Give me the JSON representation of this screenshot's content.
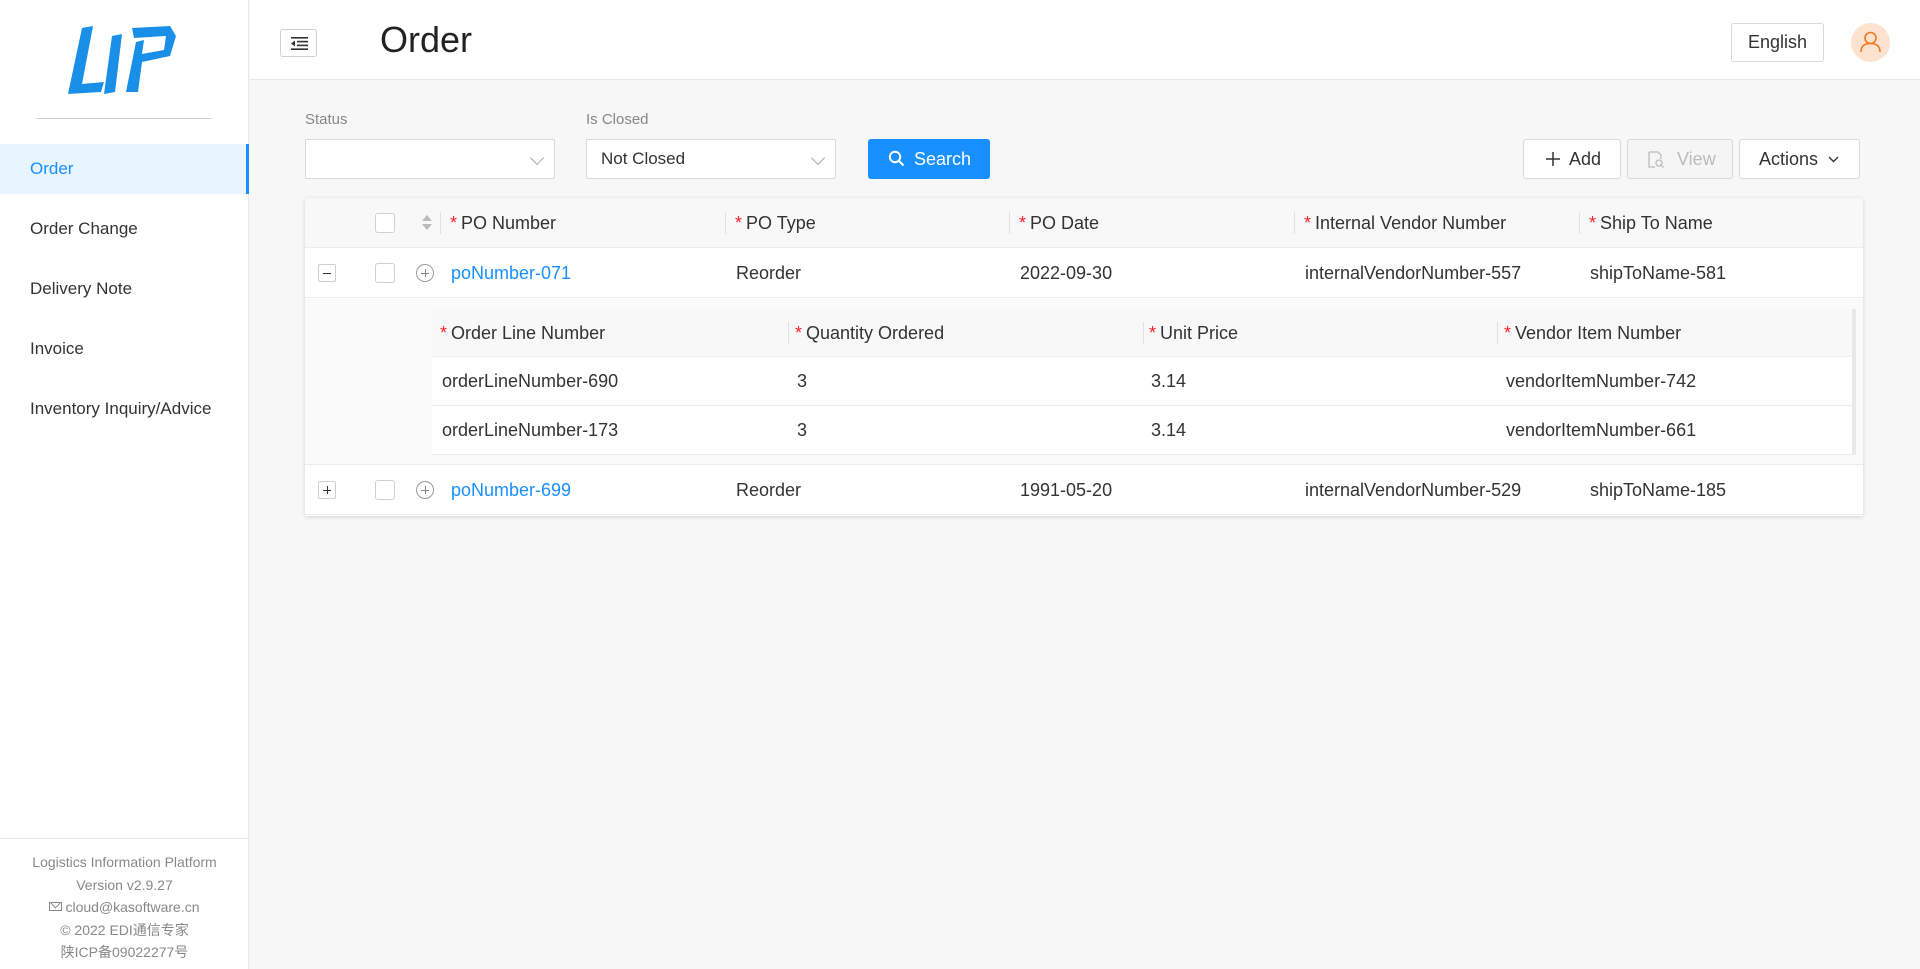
{
  "sidebar": {
    "logo_text": "LIP",
    "items": [
      {
        "label": "Order",
        "active": true
      },
      {
        "label": "Order Change",
        "active": false
      },
      {
        "label": "Delivery Note",
        "active": false
      },
      {
        "label": "Invoice",
        "active": false
      },
      {
        "label": "Inventory Inquiry/Advice",
        "active": false
      }
    ],
    "footer": {
      "platform": "Logistics Information Platform",
      "version": "Version v2.9.27",
      "email": "cloud@kasoftware.cn",
      "copyright": "© 2022 EDI通信专家",
      "icp": "陕ICP备09022277号"
    }
  },
  "header": {
    "title": "Order",
    "language": "English"
  },
  "filters": {
    "status_label": "Status",
    "status_value": "",
    "is_closed_label": "Is Closed",
    "is_closed_value": "Not Closed",
    "search_label": "Search"
  },
  "toolbar": {
    "add_label": "Add",
    "view_label": "View",
    "actions_label": "Actions"
  },
  "table": {
    "columns": [
      "PO Number",
      "PO Type",
      "PO Date",
      "Internal Vendor Number",
      "Ship To Name"
    ],
    "rows": [
      {
        "po_number": "poNumber-071",
        "po_type": "Reorder",
        "po_date": "2022-09-30",
        "vendor": "internalVendorNumber-557",
        "ship_to": "shipToName-581",
        "expanded": true
      },
      {
        "po_number": "poNumber-699",
        "po_type": "Reorder",
        "po_date": "1991-05-20",
        "vendor": "internalVendorNumber-529",
        "ship_to": "shipToName-185",
        "expanded": false
      }
    ],
    "subtable": {
      "columns": [
        "Order Line Number",
        "Quantity Ordered",
        "Unit Price",
        "Vendor Item Number"
      ],
      "rows": [
        {
          "line": "orderLineNumber-690",
          "qty": "3",
          "price": "3.14",
          "item": "vendorItemNumber-742"
        },
        {
          "line": "orderLineNumber-173",
          "qty": "3",
          "price": "3.14",
          "item": "vendorItemNumber-661"
        }
      ]
    }
  },
  "colors": {
    "primary": "#1890ff",
    "required": "#f5222d",
    "active_bg": "#e8f4ff",
    "avatar_bg": "#fde3cf",
    "avatar_fg": "#f07a22"
  }
}
